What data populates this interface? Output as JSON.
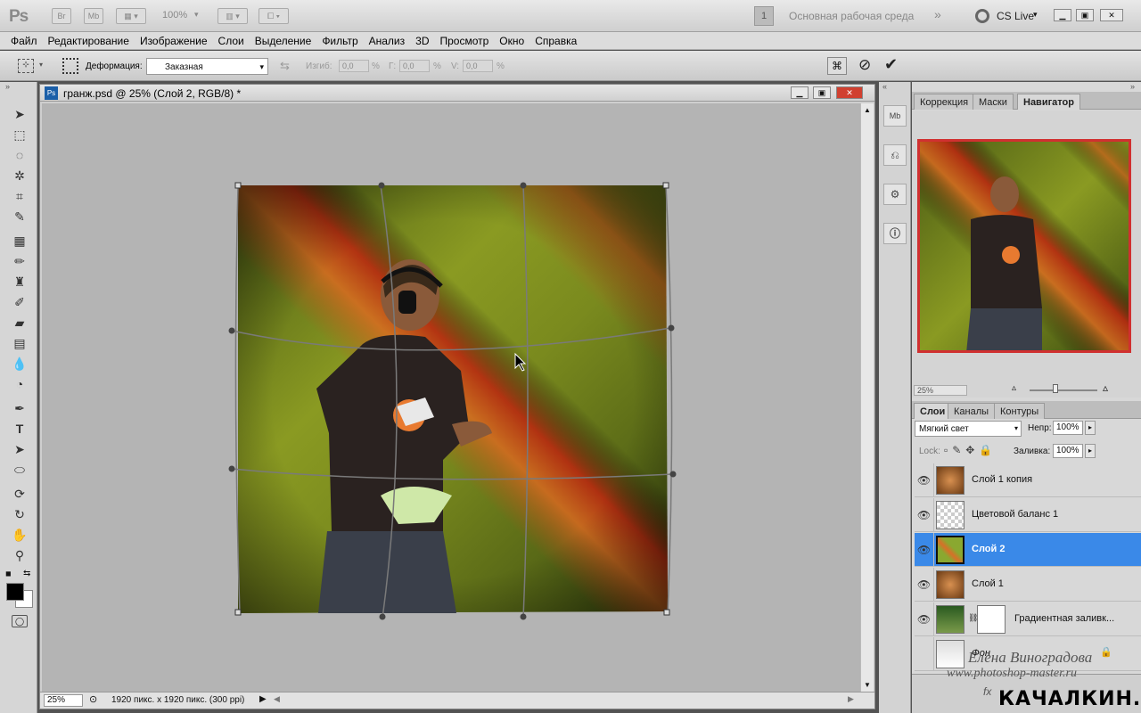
{
  "app": {
    "logo": "Ps",
    "br_label": "Br",
    "mb_label": "Mb",
    "zoom_value": "100%",
    "workspace_number": "1",
    "workspace_name": "Основная рабочая среда",
    "cs_live": "CS Live"
  },
  "menu": [
    "Файл",
    "Редактирование",
    "Изображение",
    "Слои",
    "Выделение",
    "Фильтр",
    "Анализ",
    "3D",
    "Просмотр",
    "Окно",
    "Справка"
  ],
  "options": {
    "deform_label": "Деформация:",
    "deform_value": "Заказная",
    "bend_label": "Изгиб:",
    "bend_value": "0,0",
    "h_label": "Г:",
    "h_value": "0,0",
    "v_label": "V:",
    "v_value": "0,0",
    "pct": "%"
  },
  "document": {
    "title": "гранж.psd @ 25% (Слой 2, RGB/8) *",
    "zoom": "25%",
    "info": "1920 пикс. x 1920 пикс. (300 ppi)"
  },
  "right_panel": {
    "tabs": [
      "Коррекция",
      "Маски",
      "Навигатор"
    ],
    "active_tab": "Навигатор",
    "nav_zoom": "25%",
    "layer_tabs": [
      "Слои",
      "Каналы",
      "Контуры"
    ],
    "blend_mode": "Мягкий свет",
    "opacity_label": "Непр:",
    "opacity_value": "100%",
    "lock_label": "Lock:",
    "fill_label": "Заливка:",
    "fill_value": "100%",
    "layers": [
      {
        "name": "Слой 1 копия",
        "visible": true,
        "selected": false
      },
      {
        "name": "Цветовой баланс 1",
        "visible": true,
        "selected": false
      },
      {
        "name": "Слой 2",
        "visible": true,
        "selected": true
      },
      {
        "name": "Слой 1",
        "visible": true,
        "selected": false
      },
      {
        "name": "Градиентная заливк...",
        "visible": true,
        "selected": false
      },
      {
        "name": "Фон",
        "visible": false,
        "selected": false
      }
    ]
  },
  "watermark": {
    "line1": "Елена Виноградова",
    "line2": "www.photoshop-master.ru",
    "line3": "КАЧАЛКИН.РУ"
  },
  "colors": {
    "selection": "#3a89e8",
    "accent_nav_border": "#d03030"
  }
}
